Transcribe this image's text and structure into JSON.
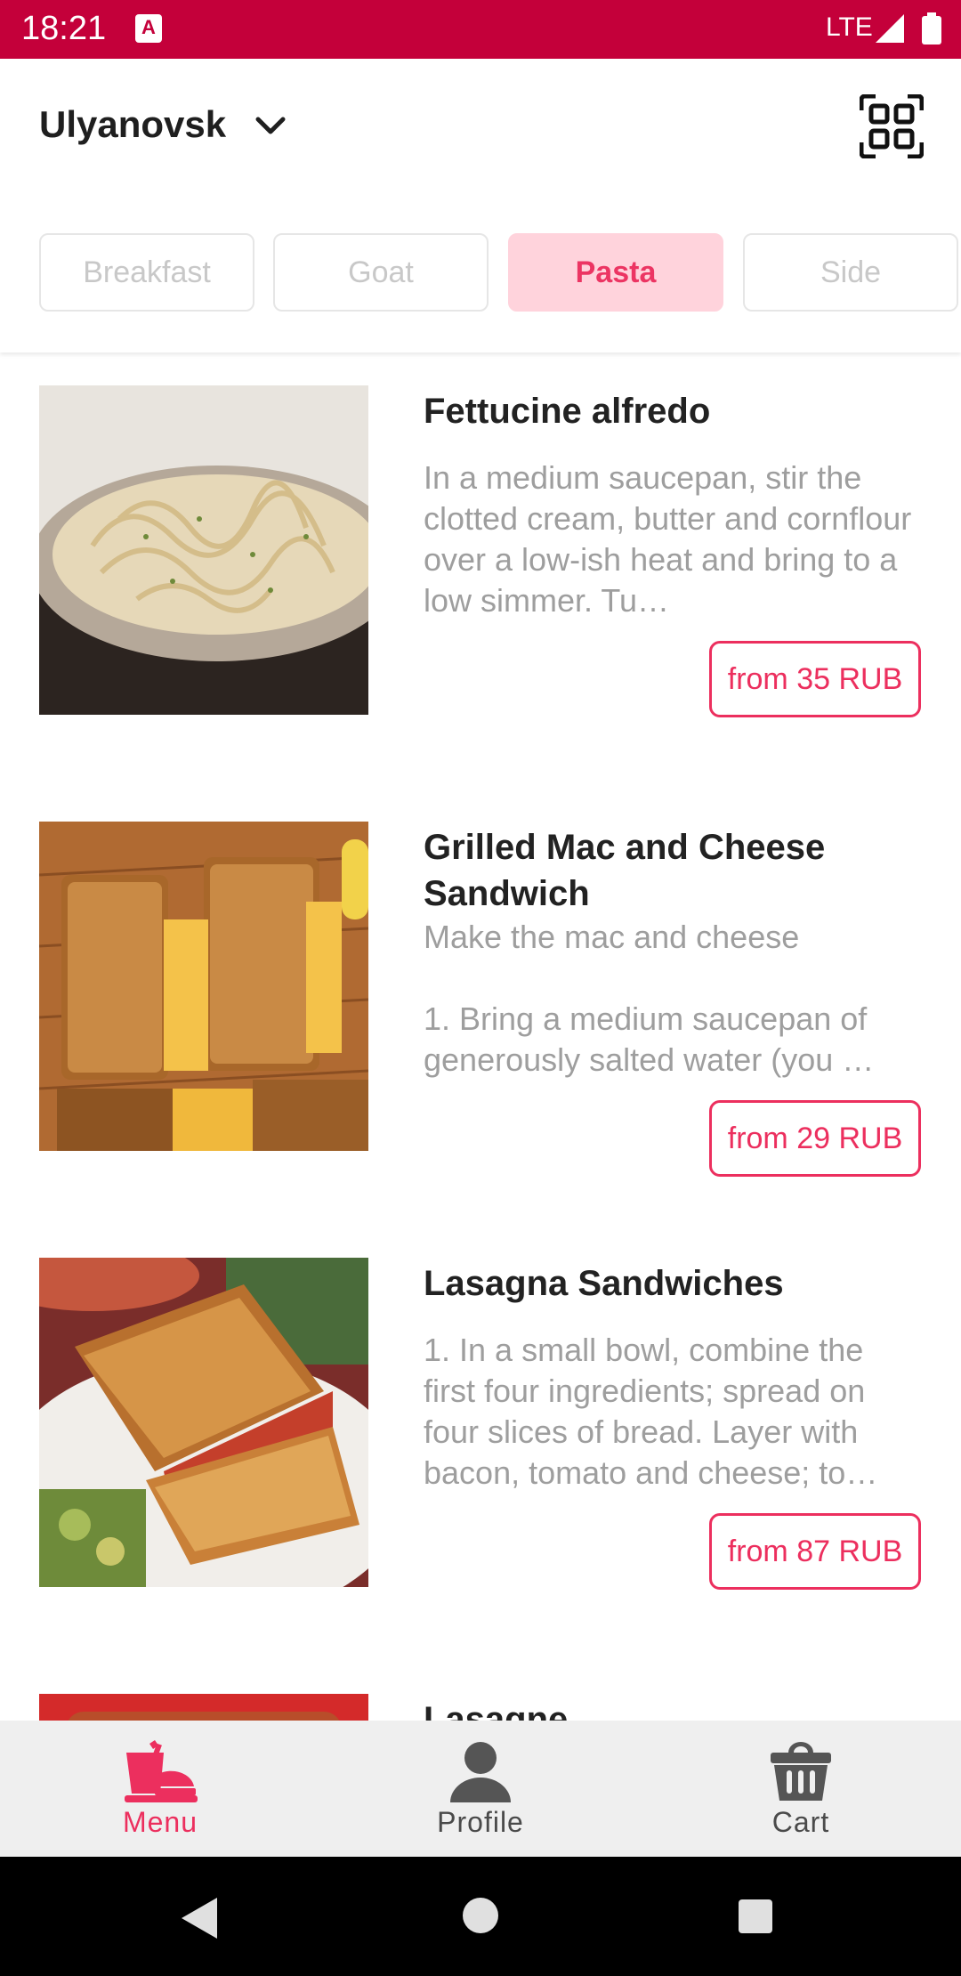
{
  "status_bar": {
    "time": "18:21",
    "network": "LTE"
  },
  "header": {
    "city": "Ulyanovsk"
  },
  "categories": [
    {
      "label": "Breakfast",
      "active": false
    },
    {
      "label": "Goat",
      "active": false
    },
    {
      "label": "Pasta",
      "active": true
    },
    {
      "label": "Side",
      "active": false
    }
  ],
  "items": [
    {
      "title": "Fettucine alfredo",
      "description": "In a medium saucepan, stir the clotted cream, butter and cornflour over a low-ish heat and bring to a low simmer. Tu…",
      "price": "from 35 RUB"
    },
    {
      "title": "Grilled Mac and Cheese Sandwich",
      "description": "Make the mac and cheese\n\n1. Bring a medium saucepan of generously salted water (you …",
      "price": "from 29 RUB"
    },
    {
      "title": "Lasagna Sandwiches",
      "description": "1. In a small bowl, combine the first four ingredients; spread on four slices of bread. Layer with bacon, tomato and cheese; to…",
      "price": "from 87 RUB"
    },
    {
      "title": "Lasagne",
      "description": "",
      "price": ""
    }
  ],
  "bottom_nav": [
    {
      "label": "Menu",
      "icon": "menu-food-icon",
      "active": true
    },
    {
      "label": "Profile",
      "icon": "person-icon",
      "active": false
    },
    {
      "label": "Cart",
      "icon": "basket-icon",
      "active": false
    }
  ],
  "colors": {
    "accent": "#ec2f5e",
    "status_bar": "#c4003a",
    "active_tab_bg": "#ffd3dc"
  }
}
